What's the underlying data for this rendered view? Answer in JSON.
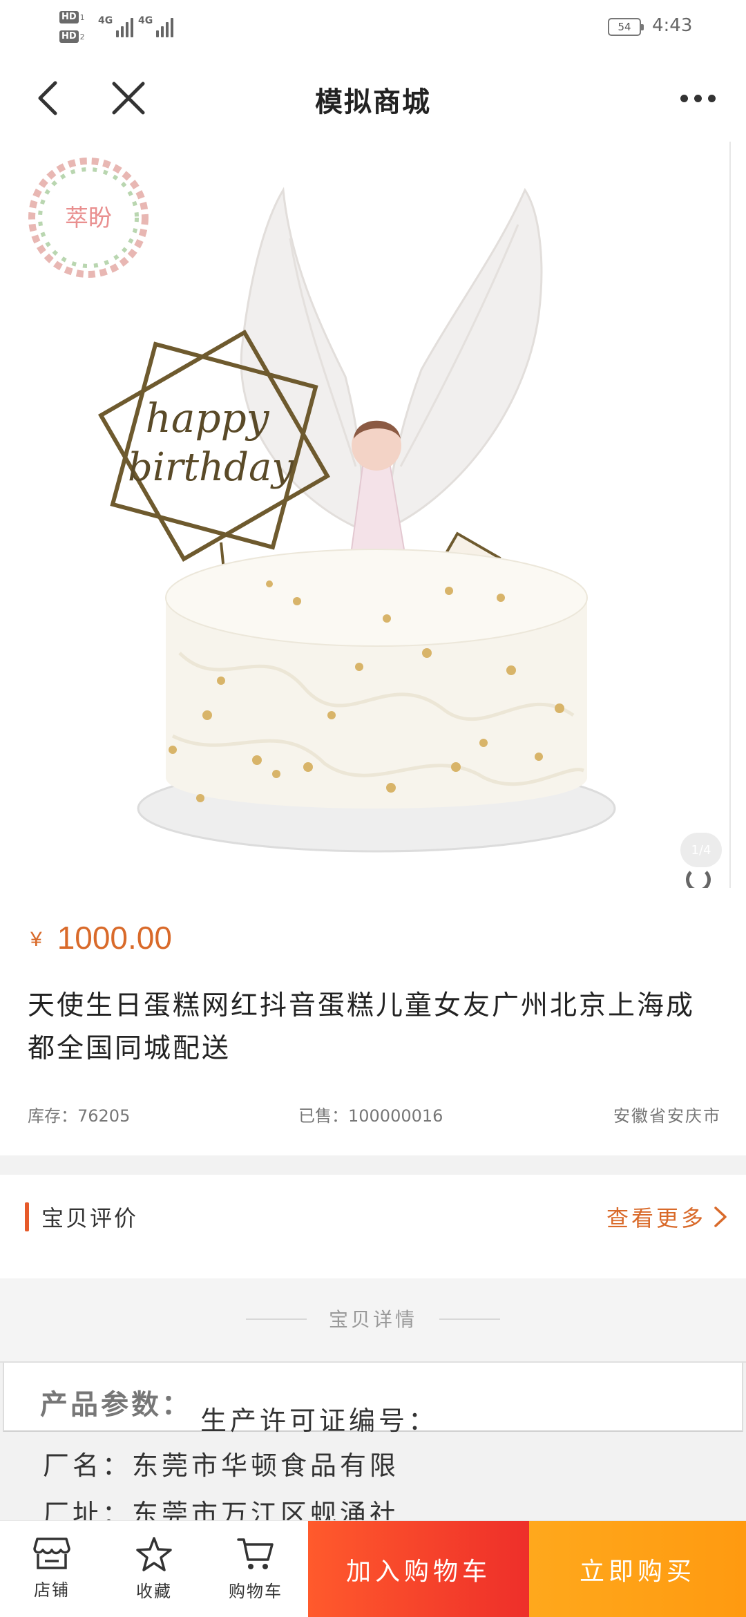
{
  "status_bar": {
    "hd1": "HD",
    "hd1_sub": "1",
    "hd2": "HD",
    "hd2_sub": "2",
    "net1": "4G",
    "net2": "4G",
    "battery": "54",
    "time": "4:43"
  },
  "nav": {
    "title": "模拟商城",
    "back_icon": "chevron-left-icon",
    "close_icon": "close-icon",
    "more_icon": "more-dots-icon"
  },
  "hero": {
    "watermark": "萃盼",
    "topper_text_1": "happy",
    "topper_text_2": "birthday",
    "pager": "1/4"
  },
  "product": {
    "currency": "¥",
    "price": "1000.00",
    "title": "天使生日蛋糕网红抖音蛋糕儿童女友广州北京上海成都全国同城配送",
    "stock": "库存：76205",
    "sold": "已售：100000016",
    "location": "安徽省安庆市"
  },
  "reviews": {
    "title": "宝贝评价",
    "more": "查看更多"
  },
  "details": {
    "title": "宝贝详情",
    "params_head": "产品参数：",
    "license": "生产许可证编号：",
    "factory": "厂名：东莞市华顿食品有限",
    "address": "厂址：东莞市万江区蚬涌社"
  },
  "bottom_bar": {
    "shop": "店铺",
    "favorite": "收藏",
    "cart": "购物车",
    "add_to_cart": "加入购物车",
    "buy_now": "立即购买"
  },
  "colors": {
    "accent": "#d96a2a",
    "add_cart": "#f24a2b",
    "buy_now": "#ffa116"
  }
}
